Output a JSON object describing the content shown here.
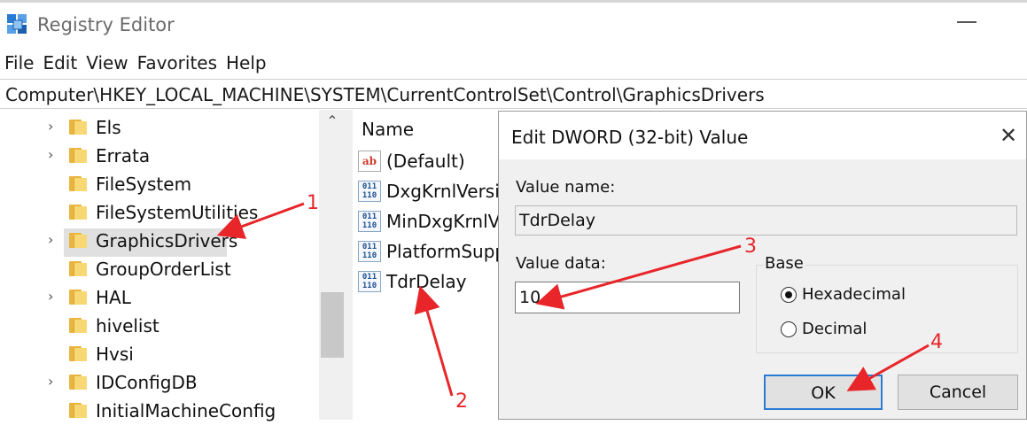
{
  "window": {
    "title": "Registry Editor"
  },
  "menu": [
    "File",
    "Edit",
    "View",
    "Favorites",
    "Help"
  ],
  "address": "Computer\\HKEY_LOCAL_MACHINE\\SYSTEM\\CurrentControlSet\\Control\\GraphicsDrivers",
  "tree": [
    {
      "label": "Els",
      "expandable": true
    },
    {
      "label": "Errata",
      "expandable": true
    },
    {
      "label": "FileSystem",
      "expandable": false
    },
    {
      "label": "FileSystemUtilities",
      "expandable": false
    },
    {
      "label": "GraphicsDrivers",
      "expandable": true,
      "selected": true
    },
    {
      "label": "GroupOrderList",
      "expandable": false
    },
    {
      "label": "HAL",
      "expandable": true
    },
    {
      "label": "hivelist",
      "expandable": false
    },
    {
      "label": "Hvsi",
      "expandable": false
    },
    {
      "label": "IDConfigDB",
      "expandable": true
    },
    {
      "label": "InitialMachineConfig",
      "expandable": false
    }
  ],
  "list": {
    "column_name": "Name",
    "items": [
      {
        "label": "(Default)",
        "icon": "string-value-icon"
      },
      {
        "label": "DxgKrnlVersio",
        "icon": "dword-value-icon"
      },
      {
        "label": "MinDxgKrnlVe",
        "icon": "dword-value-icon"
      },
      {
        "label": "PlatformSuppo",
        "icon": "dword-value-icon"
      },
      {
        "label": "TdrDelay",
        "icon": "dword-value-icon"
      }
    ]
  },
  "dialog": {
    "title": "Edit DWORD (32-bit) Value",
    "value_name_label": "Value name:",
    "value_name": "TdrDelay",
    "value_data_label": "Value data:",
    "value_data": "10",
    "base_label": "Base",
    "base_options": [
      {
        "label": "Hexadecimal",
        "checked": true
      },
      {
        "label": "Decimal",
        "checked": false
      }
    ],
    "ok_label": "OK",
    "cancel_label": "Cancel"
  },
  "annotations": [
    "1",
    "2",
    "3",
    "4"
  ],
  "colors": {
    "annotation": "#e8262a",
    "selection": "#e0e0e0",
    "focus_border": "#2a7bd4"
  }
}
